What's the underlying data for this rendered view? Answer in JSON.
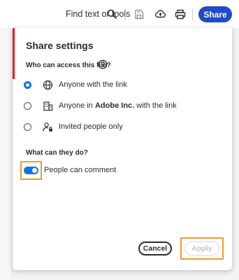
{
  "toolbar": {
    "find_label": "Find text or tools",
    "share_label": "Share",
    "share_color": "#1f4bc4"
  },
  "icons": {
    "find": "search-icon",
    "save": "save-file-icon",
    "upload": "cloud-upload-icon",
    "print": "printer-icon"
  },
  "dialog": {
    "title": "Share settings",
    "accent_color": "#e0242e",
    "access_question": "Who can access this file?",
    "options": [
      {
        "prefix": "Anyone with the link",
        "org": "",
        "suffix": "",
        "icon": "globe-icon",
        "selected": true
      },
      {
        "prefix": "Anyone in ",
        "org": "Adobe Inc.",
        "suffix": " with the link",
        "icon": "building-icon",
        "selected": false
      },
      {
        "prefix": "Invited people only",
        "org": "",
        "suffix": "",
        "icon": "person-lock-icon",
        "selected": false
      }
    ],
    "permissions_question": "What can they do?",
    "comment_toggle": {
      "label": "People can comment",
      "on": true
    },
    "cancel_label": "Cancel",
    "apply_label": "Apply",
    "apply_enabled": false,
    "highlight_color": "#f29a2e",
    "selection_color": "#1473e6"
  }
}
